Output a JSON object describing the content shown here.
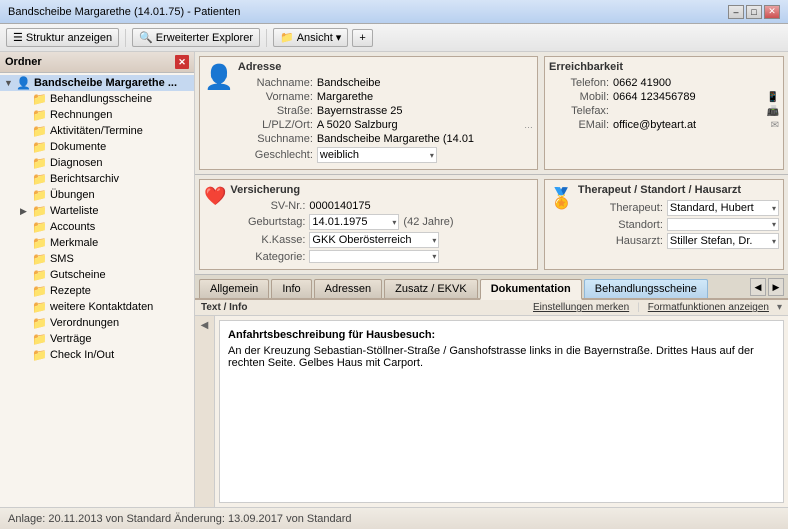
{
  "titleBar": {
    "title": "Bandscheibe Margarethe (14.01.75) - Patienten",
    "minBtn": "–",
    "maxBtn": "□",
    "closeBtn": "✕"
  },
  "toolbar": {
    "structureBtn": "Struktur anzeigen",
    "explorerBtn": "Erweiterter Explorer",
    "viewBtn": "Ansicht",
    "addBtn": "+"
  },
  "sidebar": {
    "header": "Ordner",
    "rootItem": "Bandscheibe Margarethe ...",
    "items": [
      {
        "id": "behandlungsscheine",
        "label": "Behandlungsscheine",
        "indent": true
      },
      {
        "id": "rechnungen",
        "label": "Rechnungen",
        "indent": true
      },
      {
        "id": "aktivitaeten",
        "label": "Aktivitäten/Termine",
        "indent": true
      },
      {
        "id": "dokumente",
        "label": "Dokumente",
        "indent": true
      },
      {
        "id": "diagnosen",
        "label": "Diagnosen",
        "indent": true
      },
      {
        "id": "berichtsarchiv",
        "label": "Berichtsarchiv",
        "indent": true
      },
      {
        "id": "uebungen",
        "label": "Übungen",
        "indent": true
      },
      {
        "id": "warteliste",
        "label": "Warteliste",
        "indent": true
      },
      {
        "id": "accounts",
        "label": "Accounts",
        "indent": true
      },
      {
        "id": "merkmale",
        "label": "Merkmale",
        "indent": true
      },
      {
        "id": "sms",
        "label": "SMS",
        "indent": true
      },
      {
        "id": "gutscheine",
        "label": "Gutscheine",
        "indent": true
      },
      {
        "id": "rezepte",
        "label": "Rezepte",
        "indent": true
      },
      {
        "id": "weitere",
        "label": "weitere Kontaktdaten",
        "indent": true
      },
      {
        "id": "verordnungen",
        "label": "Verordnungen",
        "indent": true
      },
      {
        "id": "vertraege",
        "label": "Verträge",
        "indent": true
      },
      {
        "id": "checkin",
        "label": "Check In/Out",
        "indent": true
      }
    ]
  },
  "address": {
    "sectionTitle": "Adresse",
    "nachnamLabel": "Nachname:",
    "nachnameValue": "Bandscheibe",
    "vornameLabel": "Vorname:",
    "vornameValue": "Margarethe",
    "strasseLabel": "Straße:",
    "strasseValue": "Bayernstrasse 25",
    "plzLabel": "L/PLZ/Ort:",
    "plzValue": "A   5020   Salzburg",
    "suchnameLabel": "Suchname:",
    "suchnameValue": "Bandscheibe Margarethe (14.01",
    "geschlechtLabel": "Geschlecht:",
    "geschlechtValue": "weiblich"
  },
  "contact": {
    "sectionTitle": "Erreichbarkeit",
    "telefonLabel": "Telefon:",
    "telefonValue": "0662      41900",
    "mobilLabel": "Mobil:",
    "mobilValue": "0664      123456789",
    "telefaxLabel": "Telefax:",
    "telefaxValue": "",
    "emailLabel": "EMail:",
    "emailValue": "office@byteart.at"
  },
  "insurance": {
    "sectionTitle": "Versicherung",
    "svnrLabel": "SV-Nr.:",
    "svnrValue": "0000140175",
    "geburtLabel": "Geburtstag:",
    "geburtValue": "14.01.1975",
    "alterValue": "(42 Jahre)",
    "kasseLabel": "K.Kasse:",
    "kasseValue": "GKK Oberösterreich",
    "kategorieLabel": "Kategorie:",
    "kategorieValue": ""
  },
  "therapist": {
    "sectionTitle": "Therapeut / Standort / Hausarzt",
    "therapeutLabel": "Therapeut:",
    "therapeutValue": "Standard, Hubert",
    "standortLabel": "Standort:",
    "standortValue": "",
    "hausarztLabel": "Hausarzt:",
    "hausarztValue": "Stiller Stefan, Dr."
  },
  "tabs": {
    "items": [
      {
        "id": "allgemein",
        "label": "Allgemein",
        "active": false
      },
      {
        "id": "info",
        "label": "Info",
        "active": false
      },
      {
        "id": "adressen",
        "label": "Adressen",
        "active": false
      },
      {
        "id": "zusatz",
        "label": "Zusatz / EKVK",
        "active": false
      },
      {
        "id": "dokumentation",
        "label": "Dokumentation",
        "active": true
      },
      {
        "id": "behandlungsscheine",
        "label": "Behandlungsscheine",
        "active": false
      }
    ]
  },
  "tabContent": {
    "tabLabel": "Text / Info",
    "settingsLink": "Einstellungen merken",
    "formatLink": "Formatfunktionen anzeigen",
    "textHeading": "Anfahrtsbeschreibung für Hausbesuch:",
    "textBody": "An der Kreuzung Sebastian-Stöllner-Straße / Ganshofstrasse links in die Bayernstraße. Drittes Haus auf der rechten Seite. Gelbes Haus mit Carport."
  },
  "statusBar": {
    "text": "Anlage: 20.11.2013 von Standard  Änderung: 13.09.2017 von Standard"
  }
}
